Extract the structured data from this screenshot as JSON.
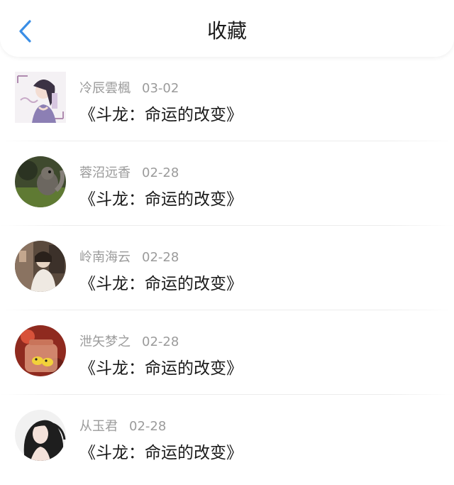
{
  "header": {
    "title": "收藏",
    "back_icon": "chevron-left-icon",
    "accent_color": "#3a8ee6"
  },
  "favorites": [
    {
      "author": "冷辰雲楓",
      "date": "03-02",
      "title": "《斗龙：命运的改变》",
      "avatar": "ink-painting-figure"
    },
    {
      "author": "蓉沼远香",
      "date": "02-28",
      "title": "《斗龙：命运的改变》",
      "avatar": "squirrel-photo"
    },
    {
      "author": "岭南海云",
      "date": "02-28",
      "title": "《斗龙：命运的改变》",
      "avatar": "person-in-room-photo"
    },
    {
      "author": "泄矢梦之",
      "date": "02-28",
      "title": "《斗龙：命运的改变》",
      "avatar": "jar-with-ducks-photo"
    },
    {
      "author": "从玉君",
      "date": "02-28",
      "title": "《斗龙：命运的改变》",
      "avatar": "woman-portrait-photo"
    }
  ]
}
